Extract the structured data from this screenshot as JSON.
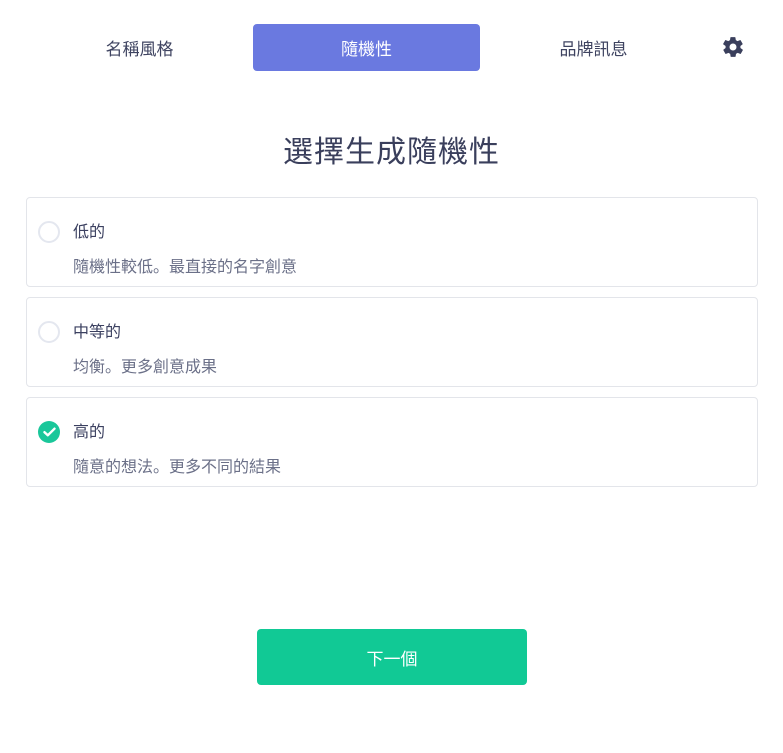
{
  "tabs": [
    {
      "label": "名稱風格",
      "active": false
    },
    {
      "label": "隨機性",
      "active": true
    },
    {
      "label": "品牌訊息",
      "active": false
    }
  ],
  "settings_icon": "gear-icon",
  "heading": "選擇生成隨機性",
  "options": [
    {
      "title": "低的",
      "description": "隨機性較低。最直接的名字創意",
      "selected": false
    },
    {
      "title": "中等的",
      "description": "均衡。更多創意成果",
      "selected": false
    },
    {
      "title": "高的",
      "description": "隨意的想法。更多不同的結果",
      "selected": true
    }
  ],
  "next_button": "下一個",
  "colors": {
    "accent": "#6a79e0",
    "success": "#11c995",
    "text": "#3d4466"
  }
}
